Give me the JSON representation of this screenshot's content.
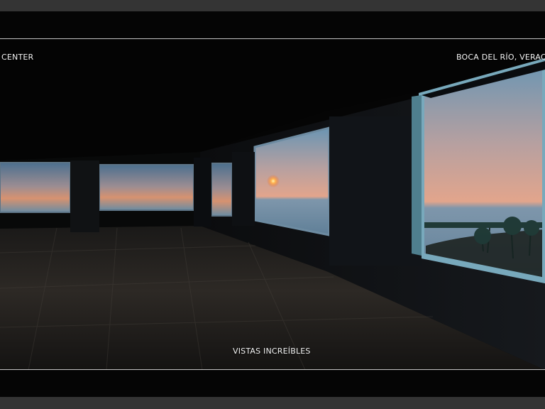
{
  "gallery": {
    "caption_left": "CENTER",
    "caption_right": "BOCA DEL RÍO, VERAC",
    "caption_bottom": "VISTAS INCREÍBLES"
  },
  "scene": {
    "image": "Interior view of an empty room with large windows overlooking a sunset over the ocean",
    "colors": {
      "frame": "#343434",
      "background": "#050505",
      "sunset_orange": "#f08a4b",
      "sea_blue": "#6d90a8",
      "floor": "#25221f"
    }
  }
}
